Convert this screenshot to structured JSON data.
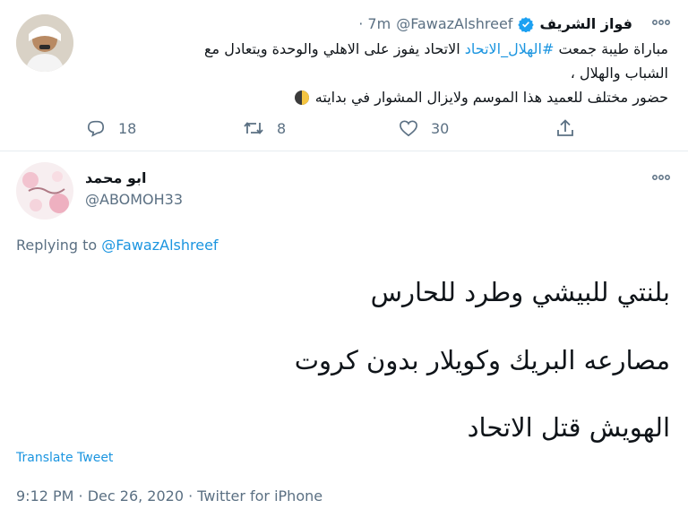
{
  "tweet": {
    "name": "فواز الشريف",
    "handle": "@FawazAlshreef",
    "time": "· 7m",
    "line1_pre": "مباراة طيبة جمعت ",
    "line1_hashtag": "#الهلال_الاتحاد",
    "line1_post": " الاتحاد يفوز على الاهلي والوحدة ويتعادل مع",
    "line2": "الشباب والهلال ،",
    "line3": "حضور مختلف للعميد هذا الموسم ولايزال المشوار في بدايته",
    "line3_emoji": "moon-emoji",
    "replies": "18",
    "retweets": "8",
    "likes": "30"
  },
  "reply": {
    "name": "ابو محمد",
    "handle": "@ABOMOH33",
    "replying_prefix": "Replying to",
    "replying_to": "@FawazAlshreef",
    "lines": [
      "بلنتي للبيشي وطرد للحارس",
      "مصارعه البريك وكويلار بدون كروت",
      "الهويش قتل الاتحاد"
    ],
    "translate": "Translate Tweet",
    "footer": "9:12 PM · Dec 26, 2020 · Twitter for iPhone"
  },
  "colors": {
    "link": "#1b95e0",
    "muted": "#5b7083",
    "verified": "#1da1f2"
  }
}
